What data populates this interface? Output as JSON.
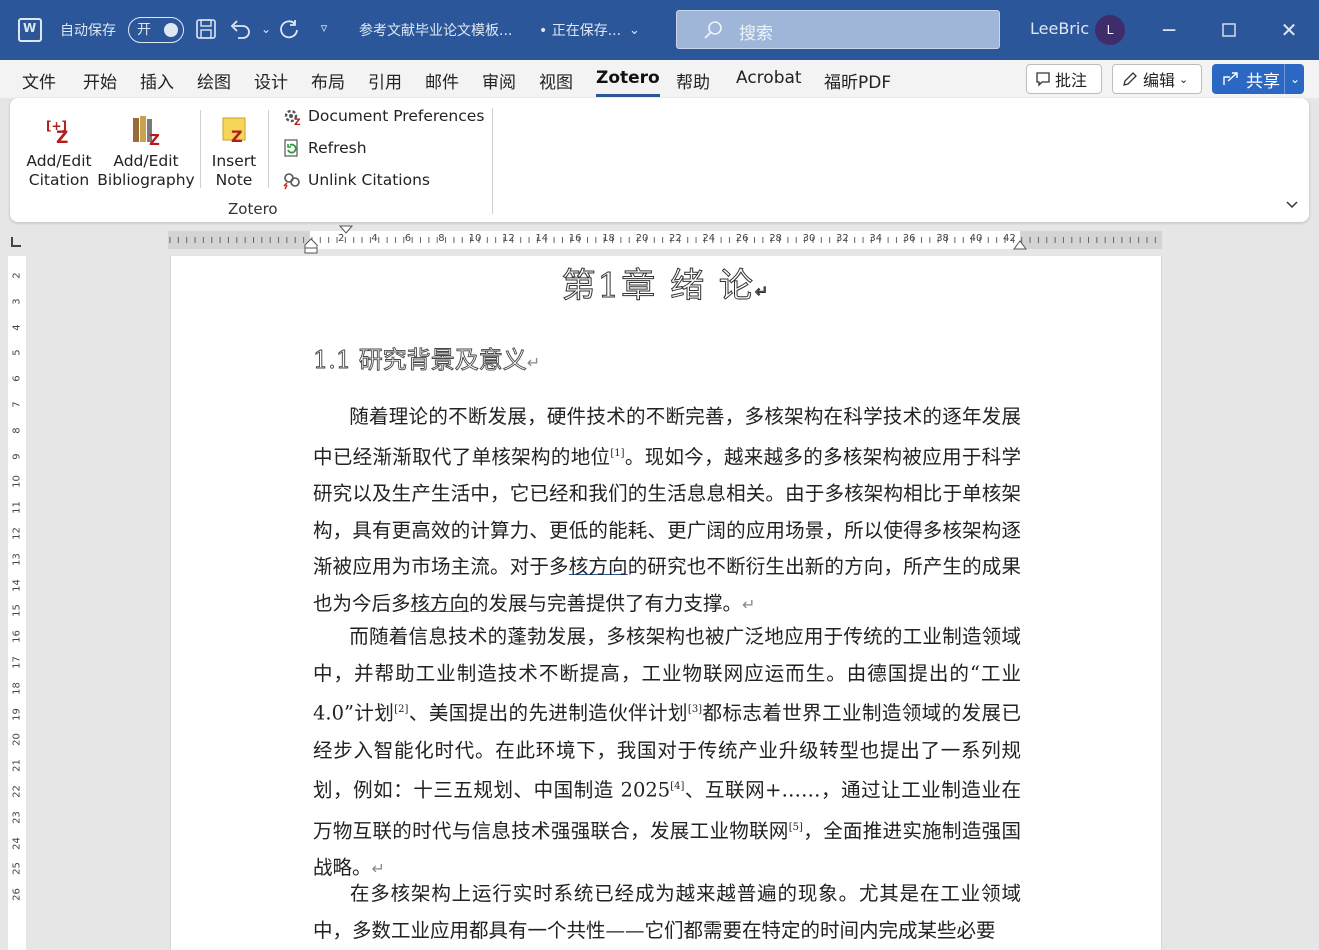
{
  "titlebar": {
    "autosave_label": "自动保存",
    "autosave_state": "开",
    "doc_title": "参考文献毕业论文模板...",
    "save_status": "• 正在保存...",
    "search_placeholder": "搜索",
    "user_name": "LeeBric",
    "avatar_initial": "L"
  },
  "menu": {
    "items": [
      "文件",
      "开始",
      "插入",
      "绘图",
      "设计",
      "布局",
      "引用",
      "邮件",
      "审阅",
      "视图",
      "Zotero",
      "帮助",
      "Acrobat",
      "福昕PDF"
    ],
    "active": "Zotero",
    "comment_button": "批注",
    "edit_button": "编辑",
    "share_button": "共享"
  },
  "ribbon": {
    "add_citation_line1": "Add/Edit",
    "add_citation_line2": "Citation",
    "add_bibliography_line1": "Add/Edit",
    "add_bibliography_line2": "Bibliography",
    "insert_note_line1": "Insert",
    "insert_note_line2": "Note",
    "doc_prefs": "Document Preferences",
    "refresh": "Refresh",
    "unlink": "Unlink Citations",
    "group_label": "Zotero"
  },
  "ruler": {
    "h_numbers": [
      "2",
      "4",
      "6",
      "8",
      "10",
      "12",
      "14",
      "16",
      "18",
      "20",
      "22",
      "24",
      "26",
      "28",
      "30",
      "32",
      "34",
      "36",
      "38",
      "40",
      "42"
    ],
    "v_numbers": [
      "2",
      "3",
      "4",
      "5",
      "6",
      "7",
      "8",
      "9",
      "10",
      "11",
      "12",
      "13",
      "14",
      "15",
      "16",
      "17",
      "18",
      "19",
      "20",
      "21",
      "22",
      "23",
      "24",
      "25",
      "26"
    ]
  },
  "document": {
    "chapter_title": "第1章 绪 论",
    "section_title": "1.1 研究背景及意义",
    "p1_a": "随着理论的不断发展，硬件技术的不断完善，多核架构在科学技术的逐年发展中已经渐渐取代了单核架构的地位",
    "p1_ref1": "[1]",
    "p1_b": "。现如今，越来越多的多核架构被应用于科学研究以及生产生活中，它已经和我们的生活息息相关。由于多核架构相比于单核架构，具有更高效的计算力、更低的能耗、更广阔的应用场景，所以使得多核架构逐渐被应用为市场主流。对于多",
    "p1_u1": "核方向",
    "p1_c": "的研究也不断衍生出新的方向，所产生的成果也为今后多",
    "p1_u2": "核方向",
    "p1_d": "的发展与完善提供了有力支撑。",
    "p2_a": "而随着信息技术的蓬勃发展，多核架构也被广泛地应用于传统的工业制造领域中，并帮助工业制造技术不断提高，工业物联网应运而生。由德国提出的“工业 4.0”计划",
    "p2_ref1": "[2]",
    "p2_b": "、美国提出的先进制造伙伴计划",
    "p2_ref2": "[3]",
    "p2_c": "都标志着世界工业制造领域的发展已经步入智能化时代。在此环境下，我国对于传统产业升级转型也提出了一系列规划，例如：十三五规划、中国制造 2025",
    "p2_ref3": "[4]",
    "p2_d": "、互联网+……，通过让工业制造业在万物互联的时代与信息技术强强联合，发展工业物联网",
    "p2_ref4": "[5]",
    "p2_e": "，全面推进实施制造强国战略。",
    "p3_a": "在多核架构上运行实时系统已经成为越来越普遍的现象。尤其是在工业领域中，多数工业应用都具有一个共性——它们都需要在特定的时间内完成某些必要"
  },
  "colors": {
    "word_blue": "#2b579a",
    "share_blue": "#2b68c4"
  }
}
